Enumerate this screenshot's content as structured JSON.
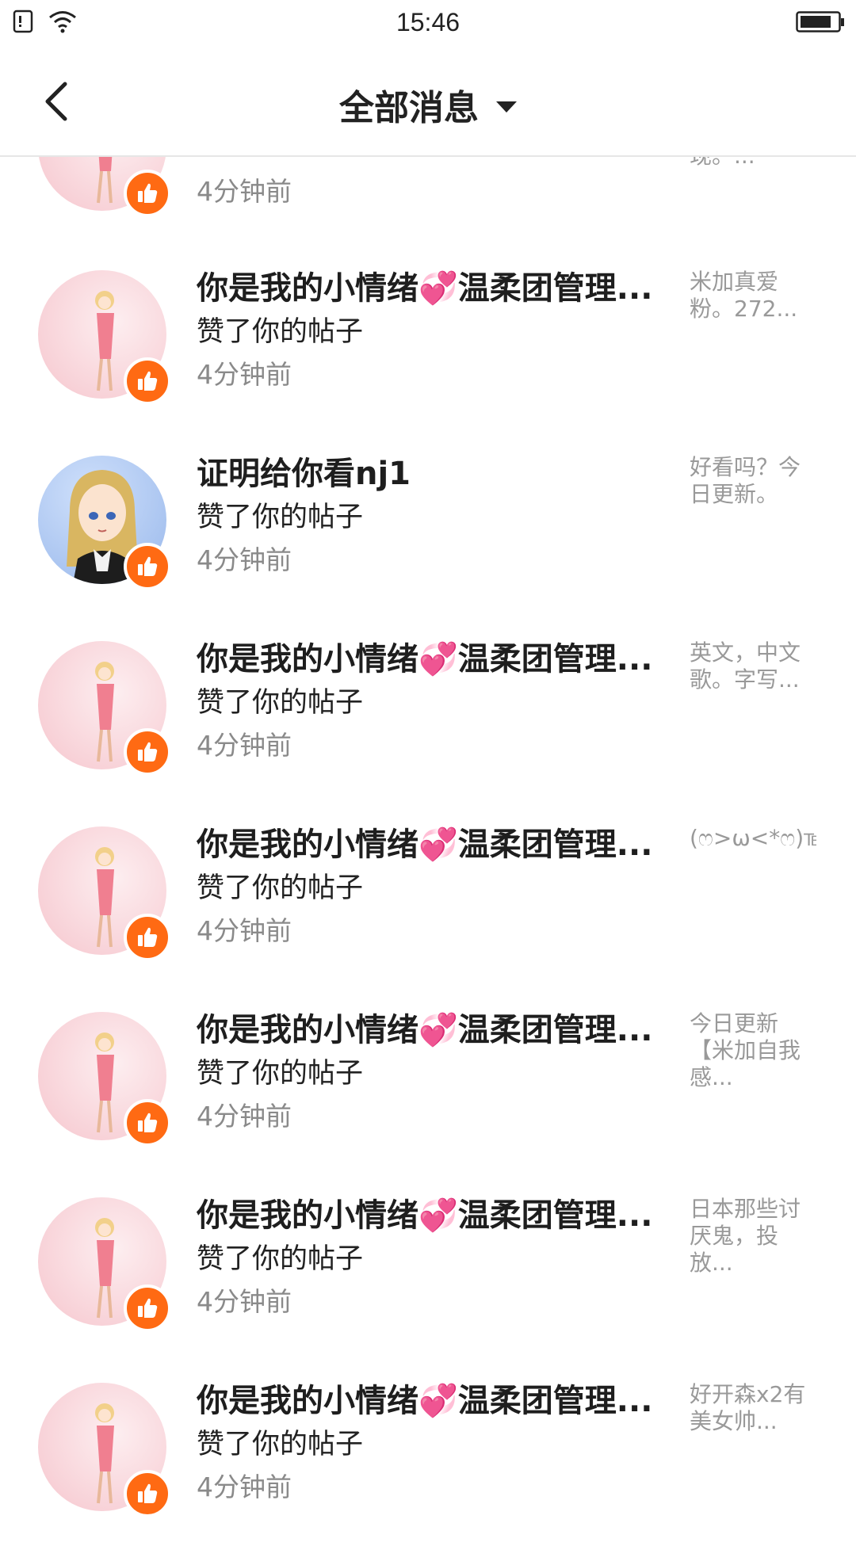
{
  "status_bar": {
    "time": "15:46"
  },
  "header": {
    "title": "全部消息"
  },
  "items": [
    {
      "name": "",
      "action": "",
      "time": "4分钟前",
      "preview": "现。..."
    },
    {
      "name": "你是我的小情绪💞温柔团管理...",
      "action": "赞了你的帖子",
      "time": "4分钟前",
      "preview": "米加真爱粉。272..."
    },
    {
      "name": "证明给你看nj1",
      "action": "赞了你的帖子",
      "time": "4分钟前",
      "preview": "好看吗？今日更新。"
    },
    {
      "name": "你是我的小情绪💞温柔团管理...",
      "action": "赞了你的帖子",
      "time": "4分钟前",
      "preview": "英文，中文歌。字写..."
    },
    {
      "name": "你是我的小情绪💞温柔团管理...",
      "action": "赞了你的帖子",
      "time": "4分钟前",
      "preview": "(ෆ>ω<*ෆ)℡♞..."
    },
    {
      "name": "你是我的小情绪💞温柔团管理...",
      "action": "赞了你的帖子",
      "time": "4分钟前",
      "preview": "今日更新【米加自我感..."
    },
    {
      "name": "你是我的小情绪💞温柔团管理...",
      "action": "赞了你的帖子",
      "time": "4分钟前",
      "preview": "日本那些讨厌鬼，投放..."
    },
    {
      "name": "你是我的小情绪💞温柔团管理...",
      "action": "赞了你的帖子",
      "time": "4分钟前",
      "preview": "好开森x2有美女帅..."
    }
  ]
}
